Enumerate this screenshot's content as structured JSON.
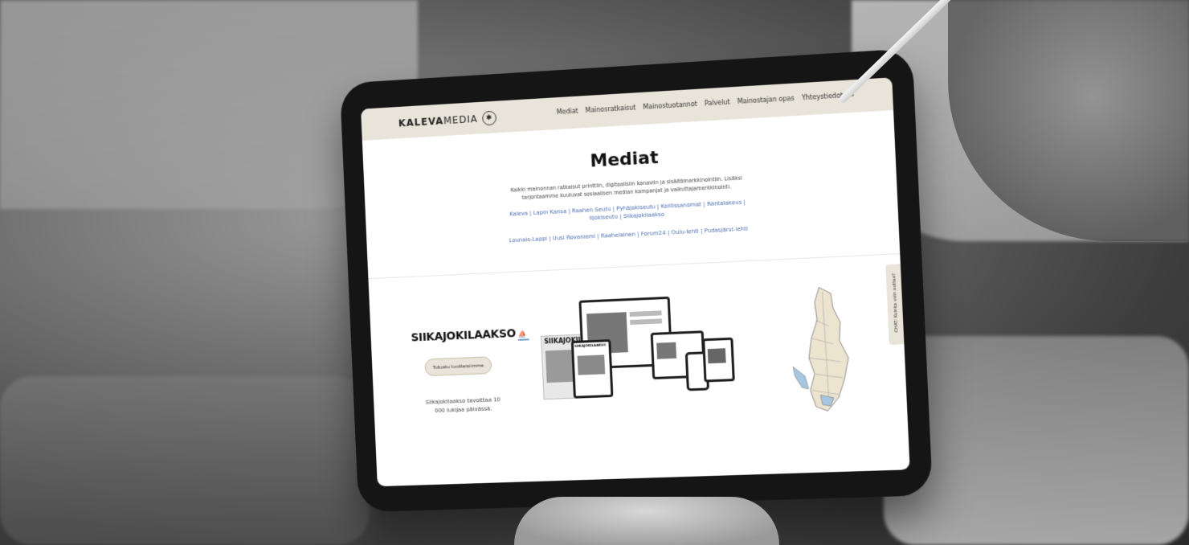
{
  "site": {
    "logo_bold": "KALEVA",
    "logo_light": "MEDIA",
    "nav": [
      "Mediat",
      "Mainosratkaisut",
      "Mainostuotannot",
      "Palvelut",
      "Mainostajan opas",
      "Yhteystiedot"
    ],
    "search_icon": "search-icon"
  },
  "page": {
    "title": "Mediat",
    "intro": "Kaikki mainonnan ratkaisut printtiin, digitaalisiin kanaviin ja sisältömarkkinointiin. Lisäksi tarjontaamme kuuluvat sosiaalisen median kampanjat ja vaikuttajamarkkinointi.",
    "links_row1": "Kaleva | Lapin Kansa | Raahen Seutu | Pyhäjokiseutu | Koillissanomat | Rantalakeus | Iijokiseutu | Siikajokilaakso",
    "links_row2": "Lounais-Lappi | Uusi Rovaniemi | Raahelainen | Forum24 | Oulu-lehti | Pudasjärvi-lehti"
  },
  "feature": {
    "brand": "SIIKAJOKILAAKSO",
    "cta": "Tutustu tuotteisiimme",
    "reach": "Siikajokilaakso tavoittaa 10 000 lukijaa päivässä."
  },
  "mockup": {
    "paper_masthead": "SIIKAJOKILAA",
    "tablet_masthead": "SIIKAJOKILAAKSO"
  },
  "chat": {
    "label": "CHAT: Kuinka voin auttaa?"
  },
  "colors": {
    "nav_bg": "#e9e4d9",
    "link": "#4a6cb0",
    "button_border": "#c9bfa9"
  }
}
